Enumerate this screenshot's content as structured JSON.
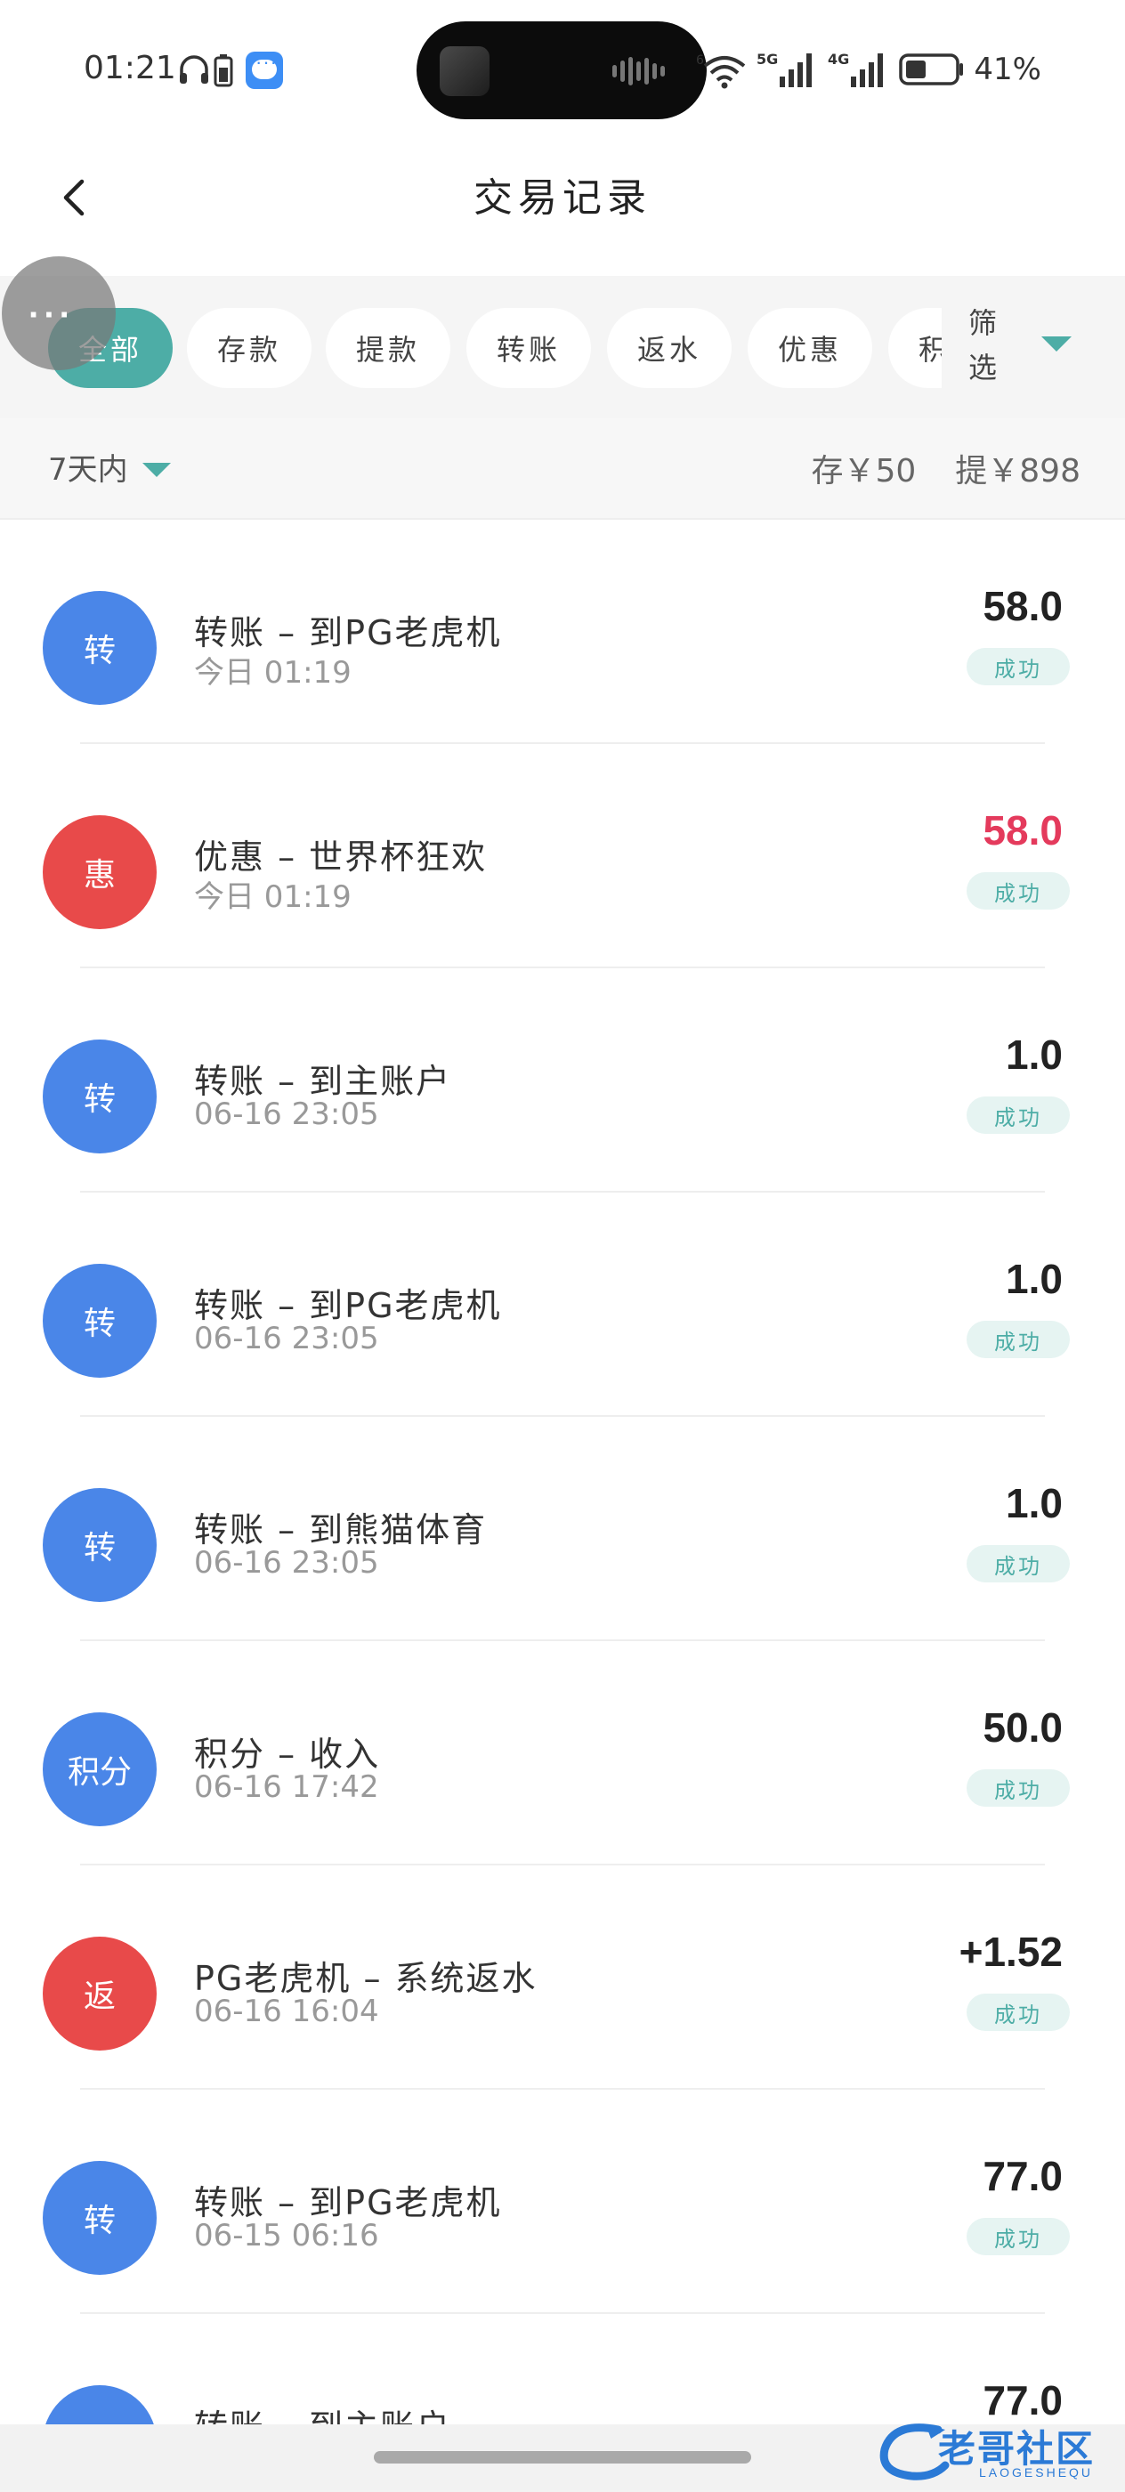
{
  "status_bar": {
    "time": "01:21",
    "battery_percent": "41%",
    "icons": [
      "headphones-icon",
      "battery-small-icon",
      "message-app-icon",
      "wifi-6-icon",
      "signal-5g-icon",
      "signal-4g-icon",
      "battery-icon"
    ]
  },
  "header": {
    "title": "交易记录"
  },
  "tabs": [
    "全部",
    "存款",
    "提款",
    "转账",
    "返水",
    "优惠",
    "积分"
  ],
  "active_tab": "全部",
  "filter_label": "筛选",
  "summary": {
    "period": "7天内",
    "deposit": "存￥50",
    "withdraw": "提￥898"
  },
  "records": [
    {
      "badge": "转",
      "badge_color": "blue",
      "title": "转账 – 到PG老虎机",
      "time": "今日 01:19",
      "amount": "58.0",
      "amount_color": "dark",
      "status": "成功"
    },
    {
      "badge": "惠",
      "badge_color": "red",
      "title": "优惠 – 世界杯狂欢",
      "time": "今日 01:19",
      "amount": "58.0",
      "amount_color": "red",
      "status": "成功"
    },
    {
      "badge": "转",
      "badge_color": "blue",
      "title": "转账 – 到主账户",
      "time": "06-16 23:05",
      "amount": "1.0",
      "amount_color": "dark",
      "status": "成功"
    },
    {
      "badge": "转",
      "badge_color": "blue",
      "title": "转账 – 到PG老虎机",
      "time": "06-16 23:05",
      "amount": "1.0",
      "amount_color": "dark",
      "status": "成功"
    },
    {
      "badge": "转",
      "badge_color": "blue",
      "title": "转账 – 到熊猫体育",
      "time": "06-16 23:05",
      "amount": "1.0",
      "amount_color": "dark",
      "status": "成功"
    },
    {
      "badge": "积分",
      "badge_color": "blue",
      "title": "积分 – 收入",
      "time": "06-16 17:42",
      "amount": "50.0",
      "amount_color": "dark",
      "status": "成功"
    },
    {
      "badge": "返",
      "badge_color": "red",
      "title": "PG老虎机 – 系统返水",
      "time": "06-16 16:04",
      "amount": "+1.52",
      "amount_color": "dark",
      "status": "成功"
    },
    {
      "badge": "转",
      "badge_color": "blue",
      "title": "转账 – 到PG老虎机",
      "time": "06-15 06:16",
      "amount": "77.0",
      "amount_color": "dark",
      "status": "成功"
    },
    {
      "badge": "转",
      "badge_color": "blue",
      "title": "转账 – 到主账户",
      "time": "",
      "amount": "77.0",
      "amount_color": "dark",
      "status": ""
    }
  ],
  "watermark": {
    "text": "老哥社区",
    "sub": "LAOGESHEQU"
  },
  "colors": {
    "accent": "#4dada6",
    "blue_badge": "#4a86e8",
    "red_badge": "#e84a4a",
    "red_amount": "#e43a5c"
  }
}
